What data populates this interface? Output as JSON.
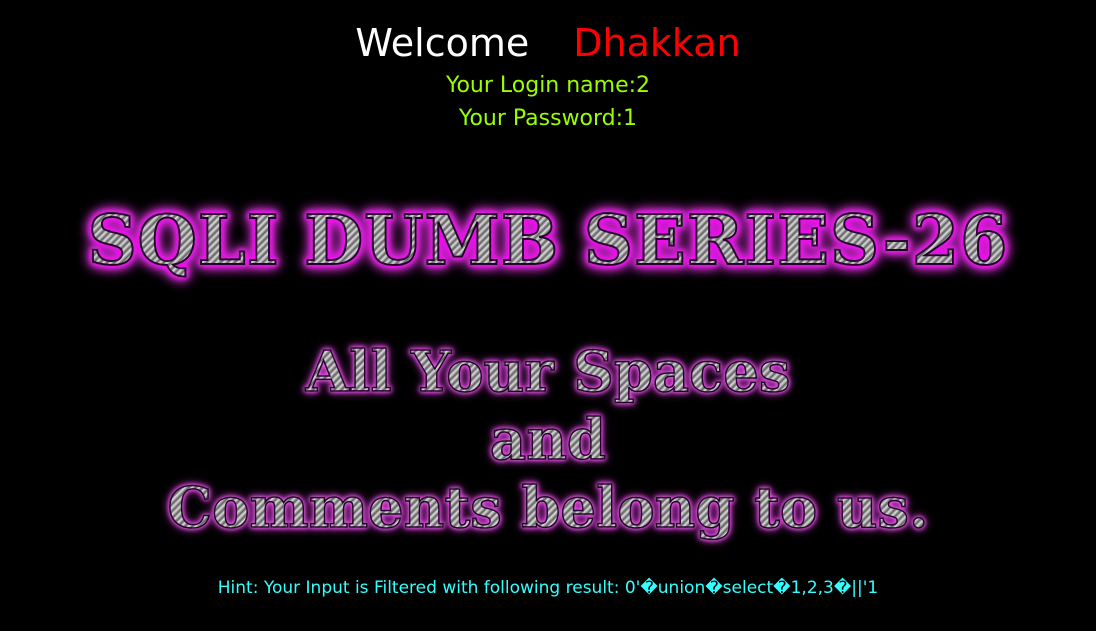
{
  "welcome": {
    "greeting": "Welcome",
    "user_name": "Dhakkan"
  },
  "login": {
    "login_name_text": "Your Login name:2",
    "password_text": "Your Password:1"
  },
  "banner": {
    "title": "SQLI DUMB SERIES-26",
    "tagline_lines": [
      "All Your Spaces",
      "and",
      "Comments belong to us."
    ]
  },
  "hint": {
    "text": "Hint: Your Input is Filtered with following result: 0'�union�select�1,2,3�||'1"
  },
  "colors": {
    "background": "#000000",
    "greeting": "#ffffff",
    "user_name": "#ff0000",
    "login_info": "#99ff00",
    "hint": "#33ffff",
    "banner_glow": "#ff00ff"
  }
}
